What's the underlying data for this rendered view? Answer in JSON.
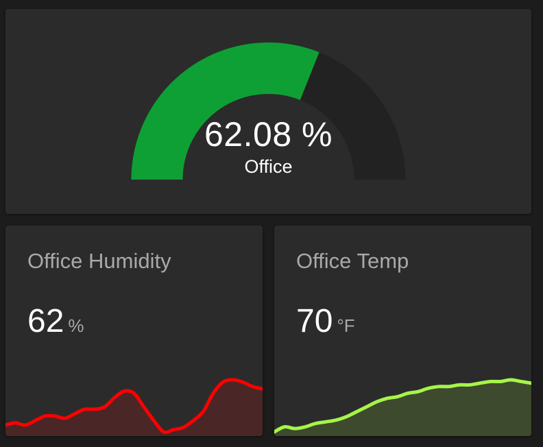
{
  "gauge": {
    "value": 62.08,
    "display_value": "62.08 %",
    "name": "Office",
    "min": 0,
    "max": 100,
    "fill_color": "#0fa035",
    "track_color": "#222222"
  },
  "humidity": {
    "name": "Office Humidity",
    "value": "62",
    "unit": "%",
    "line_color": "#ff0000",
    "fill_color": "#4a2627",
    "history": [
      30,
      31,
      30,
      32,
      34,
      34,
      33,
      35,
      37,
      37,
      38,
      42,
      45,
      44,
      38,
      32,
      27,
      28,
      29,
      32,
      36,
      44,
      49,
      50,
      49,
      47,
      46
    ]
  },
  "temp": {
    "name": "Office Temp",
    "value": "70",
    "unit": "°F",
    "line_color": "#a5f54a",
    "fill_color": "#3e4a2d",
    "history": [
      10,
      13,
      12,
      13,
      15,
      16,
      17,
      19,
      22,
      25,
      28,
      30,
      31,
      33,
      34,
      36,
      37,
      37,
      38,
      38,
      39,
      40,
      40,
      41,
      40,
      39
    ]
  }
}
